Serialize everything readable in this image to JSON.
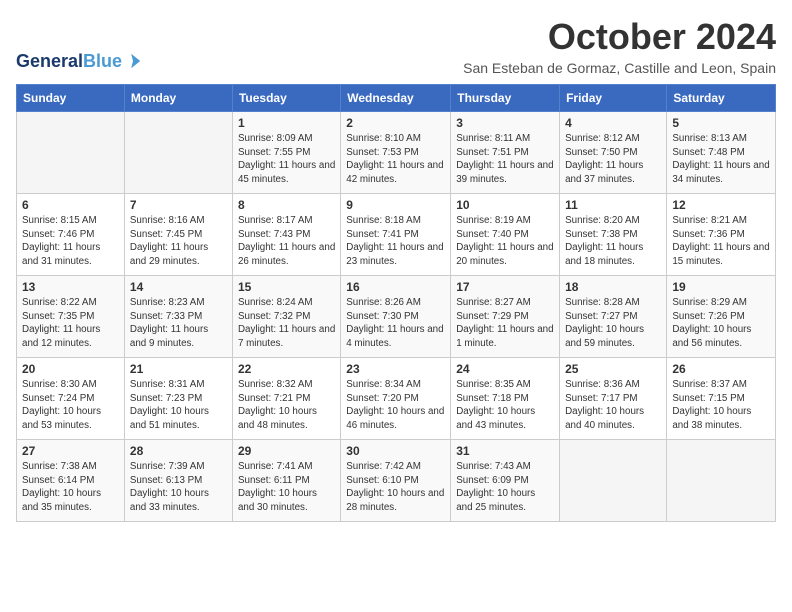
{
  "header": {
    "logo_line1": "General",
    "logo_line2": "Blue",
    "month": "October 2024",
    "location": "San Esteban de Gormaz, Castille and Leon, Spain"
  },
  "weekdays": [
    "Sunday",
    "Monday",
    "Tuesday",
    "Wednesday",
    "Thursday",
    "Friday",
    "Saturday"
  ],
  "weeks": [
    [
      {
        "day": "",
        "content": ""
      },
      {
        "day": "",
        "content": ""
      },
      {
        "day": "1",
        "content": "Sunrise: 8:09 AM\nSunset: 7:55 PM\nDaylight: 11 hours and 45 minutes."
      },
      {
        "day": "2",
        "content": "Sunrise: 8:10 AM\nSunset: 7:53 PM\nDaylight: 11 hours and 42 minutes."
      },
      {
        "day": "3",
        "content": "Sunrise: 8:11 AM\nSunset: 7:51 PM\nDaylight: 11 hours and 39 minutes."
      },
      {
        "day": "4",
        "content": "Sunrise: 8:12 AM\nSunset: 7:50 PM\nDaylight: 11 hours and 37 minutes."
      },
      {
        "day": "5",
        "content": "Sunrise: 8:13 AM\nSunset: 7:48 PM\nDaylight: 11 hours and 34 minutes."
      }
    ],
    [
      {
        "day": "6",
        "content": "Sunrise: 8:15 AM\nSunset: 7:46 PM\nDaylight: 11 hours and 31 minutes."
      },
      {
        "day": "7",
        "content": "Sunrise: 8:16 AM\nSunset: 7:45 PM\nDaylight: 11 hours and 29 minutes."
      },
      {
        "day": "8",
        "content": "Sunrise: 8:17 AM\nSunset: 7:43 PM\nDaylight: 11 hours and 26 minutes."
      },
      {
        "day": "9",
        "content": "Sunrise: 8:18 AM\nSunset: 7:41 PM\nDaylight: 11 hours and 23 minutes."
      },
      {
        "day": "10",
        "content": "Sunrise: 8:19 AM\nSunset: 7:40 PM\nDaylight: 11 hours and 20 minutes."
      },
      {
        "day": "11",
        "content": "Sunrise: 8:20 AM\nSunset: 7:38 PM\nDaylight: 11 hours and 18 minutes."
      },
      {
        "day": "12",
        "content": "Sunrise: 8:21 AM\nSunset: 7:36 PM\nDaylight: 11 hours and 15 minutes."
      }
    ],
    [
      {
        "day": "13",
        "content": "Sunrise: 8:22 AM\nSunset: 7:35 PM\nDaylight: 11 hours and 12 minutes."
      },
      {
        "day": "14",
        "content": "Sunrise: 8:23 AM\nSunset: 7:33 PM\nDaylight: 11 hours and 9 minutes."
      },
      {
        "day": "15",
        "content": "Sunrise: 8:24 AM\nSunset: 7:32 PM\nDaylight: 11 hours and 7 minutes."
      },
      {
        "day": "16",
        "content": "Sunrise: 8:26 AM\nSunset: 7:30 PM\nDaylight: 11 hours and 4 minutes."
      },
      {
        "day": "17",
        "content": "Sunrise: 8:27 AM\nSunset: 7:29 PM\nDaylight: 11 hours and 1 minute."
      },
      {
        "day": "18",
        "content": "Sunrise: 8:28 AM\nSunset: 7:27 PM\nDaylight: 10 hours and 59 minutes."
      },
      {
        "day": "19",
        "content": "Sunrise: 8:29 AM\nSunset: 7:26 PM\nDaylight: 10 hours and 56 minutes."
      }
    ],
    [
      {
        "day": "20",
        "content": "Sunrise: 8:30 AM\nSunset: 7:24 PM\nDaylight: 10 hours and 53 minutes."
      },
      {
        "day": "21",
        "content": "Sunrise: 8:31 AM\nSunset: 7:23 PM\nDaylight: 10 hours and 51 minutes."
      },
      {
        "day": "22",
        "content": "Sunrise: 8:32 AM\nSunset: 7:21 PM\nDaylight: 10 hours and 48 minutes."
      },
      {
        "day": "23",
        "content": "Sunrise: 8:34 AM\nSunset: 7:20 PM\nDaylight: 10 hours and 46 minutes."
      },
      {
        "day": "24",
        "content": "Sunrise: 8:35 AM\nSunset: 7:18 PM\nDaylight: 10 hours and 43 minutes."
      },
      {
        "day": "25",
        "content": "Sunrise: 8:36 AM\nSunset: 7:17 PM\nDaylight: 10 hours and 40 minutes."
      },
      {
        "day": "26",
        "content": "Sunrise: 8:37 AM\nSunset: 7:15 PM\nDaylight: 10 hours and 38 minutes."
      }
    ],
    [
      {
        "day": "27",
        "content": "Sunrise: 7:38 AM\nSunset: 6:14 PM\nDaylight: 10 hours and 35 minutes."
      },
      {
        "day": "28",
        "content": "Sunrise: 7:39 AM\nSunset: 6:13 PM\nDaylight: 10 hours and 33 minutes."
      },
      {
        "day": "29",
        "content": "Sunrise: 7:41 AM\nSunset: 6:11 PM\nDaylight: 10 hours and 30 minutes."
      },
      {
        "day": "30",
        "content": "Sunrise: 7:42 AM\nSunset: 6:10 PM\nDaylight: 10 hours and 28 minutes."
      },
      {
        "day": "31",
        "content": "Sunrise: 7:43 AM\nSunset: 6:09 PM\nDaylight: 10 hours and 25 minutes."
      },
      {
        "day": "",
        "content": ""
      },
      {
        "day": "",
        "content": ""
      }
    ]
  ]
}
